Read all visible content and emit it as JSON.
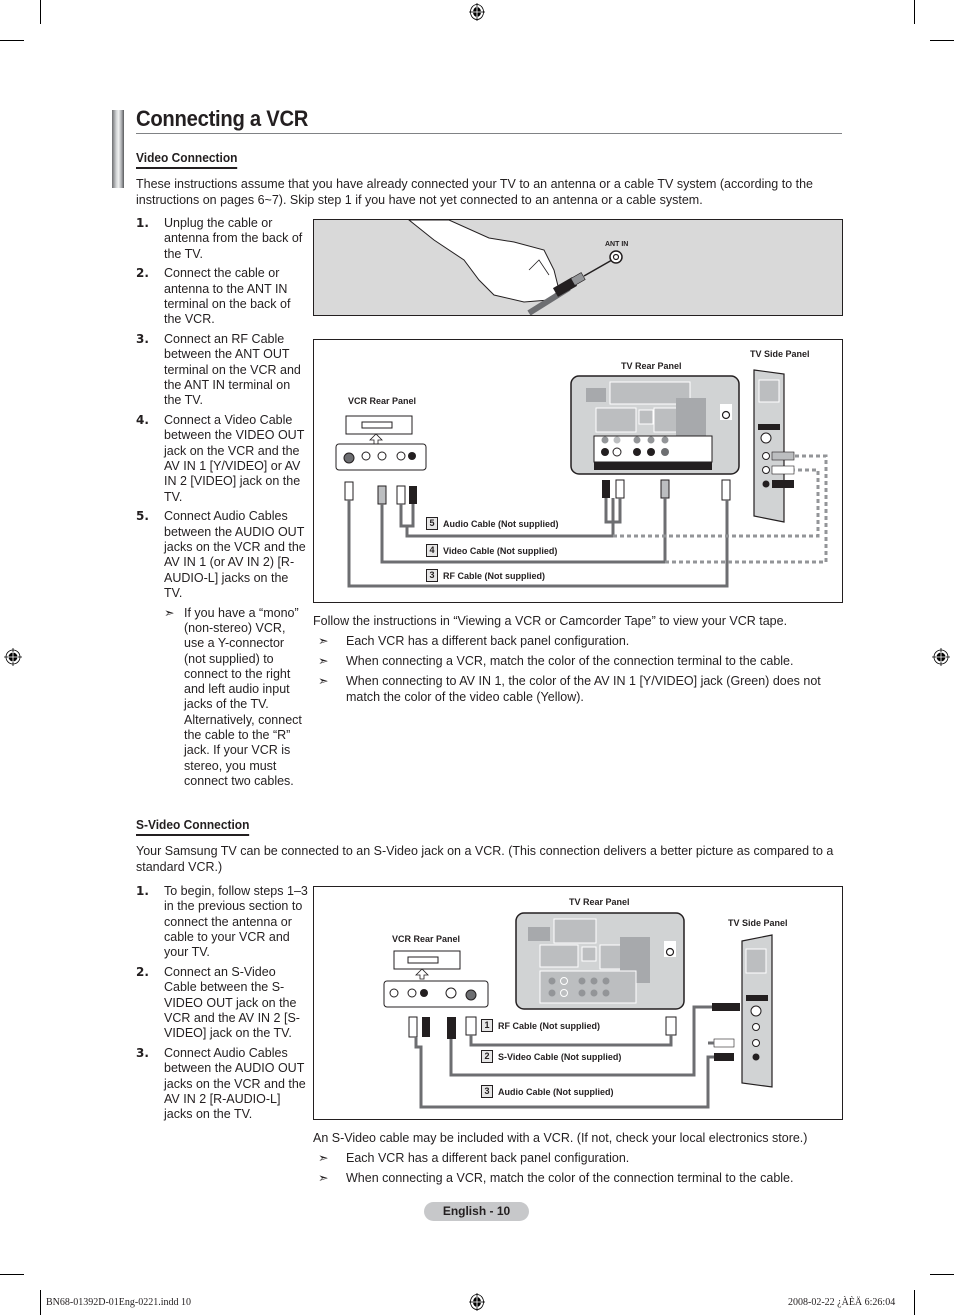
{
  "page": {
    "title": "Connecting a VCR",
    "footer_page_label": "English - 10",
    "slug_left": "BN68-01392D-01Eng-0221.indd   10",
    "slug_right": "2008-02-22   ¿ÀÈÄ 6:26:04"
  },
  "video_connection": {
    "heading": "Video Connection",
    "intro": "These instructions assume that you have already connected your TV to an antenna or a cable TV system (according to the instructions on pages 6~7). Skip step 1 if you have not yet connected to an antenna or a cable system.",
    "steps": [
      {
        "num": "1.",
        "text": "Unplug the cable or antenna from the back of the TV."
      },
      {
        "num": "2.",
        "text": "Connect the cable or antenna to the ANT IN terminal on the back of the VCR."
      },
      {
        "num": "3.",
        "text": "Connect an RF Cable between the ANT OUT terminal on the VCR and the ANT IN terminal on the TV."
      },
      {
        "num": "4.",
        "text": "Connect a Video Cable between the VIDEO OUT jack on the VCR and the AV IN 1 [Y/VIDEO] or AV IN 2 [VIDEO] jack on the TV."
      },
      {
        "num": "5.",
        "text": "Connect Audio Cables between the AUDIO OUT jacks on the VCR and the AV IN 1 (or AV IN 2) [R-AUDIO-L] jacks on the TV."
      }
    ],
    "step5_note": "If you have a “mono” (non-stereo) VCR, use a Y-connector (not supplied) to connect to the right and left audio input jacks of the TV. Alternatively, connect the cable to the “R” jack. If your VCR is stereo, you must connect two cables.",
    "diagram1": {
      "ant_in_label": "ANT IN"
    },
    "diagram2": {
      "tv_rear_panel": "TV Rear Panel",
      "tv_side_panel": "TV Side Panel",
      "vcr_rear_panel": "VCR Rear Panel",
      "cables": [
        {
          "num": "5",
          "label": "Audio Cable (Not supplied)"
        },
        {
          "num": "4",
          "label": "Video Cable (Not supplied)"
        },
        {
          "num": "3",
          "label": "RF Cable (Not supplied)"
        }
      ]
    },
    "follow_text": "Follow the instructions in “Viewing a VCR or Camcorder Tape” to view your VCR tape.",
    "notes": [
      "Each VCR has a different back panel configuration.",
      "When connecting a VCR, match the color of the connection terminal to the cable.",
      "When connecting to AV IN 1, the color of the AV IN 1 [Y/VIDEO] jack (Green) does not match the color of the video cable (Yellow)."
    ]
  },
  "svideo_connection": {
    "heading": "S-Video Connection",
    "intro": "Your Samsung TV can be connected to an S-Video jack on a VCR. (This connection delivers a better picture as compared to a standard VCR.)",
    "steps": [
      {
        "num": "1.",
        "text": "To begin, follow steps 1–3 in the previous section to connect the antenna or cable to your VCR and your TV."
      },
      {
        "num": "2.",
        "text": "Connect an S-Video Cable between the S-VIDEO OUT jack on the VCR and the AV IN 2 [S-VIDEO] jack on the TV."
      },
      {
        "num": "3.",
        "text": "Connect Audio Cables between the AUDIO OUT jacks on the VCR and the AV IN 2 [R-AUDIO-L] jacks on the TV."
      }
    ],
    "diagram": {
      "tv_rear_panel": "TV Rear Panel",
      "tv_side_panel": "TV Side Panel",
      "vcr_rear_panel": "VCR Rear Panel",
      "cables": [
        {
          "num": "1",
          "label": "RF Cable (Not supplied)"
        },
        {
          "num": "2",
          "label": "S-Video Cable (Not supplied)"
        },
        {
          "num": "3",
          "label": "Audio Cable (Not supplied)"
        }
      ]
    },
    "after_text": "An S-Video cable may be included with a VCR. (If not, check your local electronics store.)",
    "notes": [
      "Each VCR has a different back panel configuration.",
      "When connecting a VCR, match the color of the connection terminal to the cable."
    ]
  },
  "glyphs": {
    "note_arrow": "➣"
  }
}
